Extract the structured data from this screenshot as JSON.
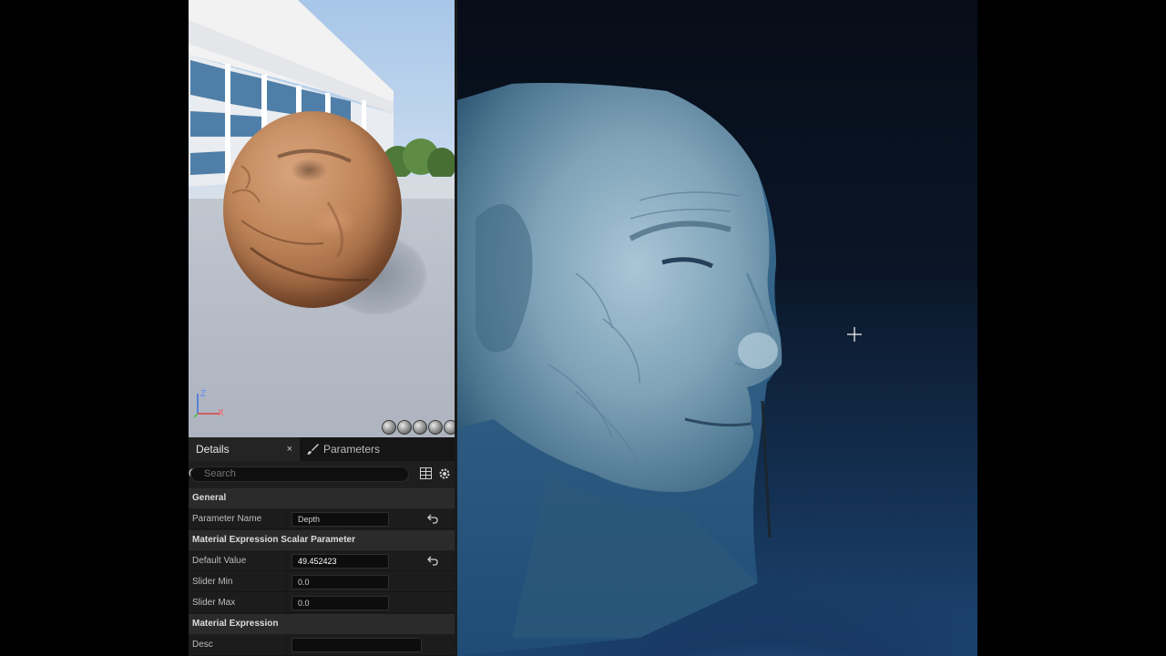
{
  "preview": {
    "axis": {
      "z_label": "Z",
      "x_label": "X"
    },
    "view_buttons": [
      "sphere-preview-icon",
      "cube-preview-icon",
      "plane-preview-icon",
      "cylinder-preview-icon",
      "mesh-preview-icon"
    ]
  },
  "details": {
    "tabs": {
      "details_label": "Details",
      "close_glyph": "×",
      "parameters_label": "Parameters"
    },
    "search": {
      "placeholder": "Search"
    },
    "sections": {
      "general": "General",
      "scalar": "Material Expression Scalar Parameter",
      "expression": "Material Expression"
    },
    "rows": {
      "parameter_name": {
        "label": "Parameter Name",
        "value": "Depth"
      },
      "default_value": {
        "label": "Default Value",
        "value": "49.452423"
      },
      "slider_min": {
        "label": "Slider Min",
        "value": "0.0"
      },
      "slider_max": {
        "label": "Slider Max",
        "value": "0.0"
      },
      "desc": {
        "label": "Desc",
        "value": ""
      }
    }
  },
  "colors": {
    "panel_bg": "#1e1e1e",
    "section_bg": "#2b2b2b",
    "viewport_blue": "#1d4572"
  }
}
